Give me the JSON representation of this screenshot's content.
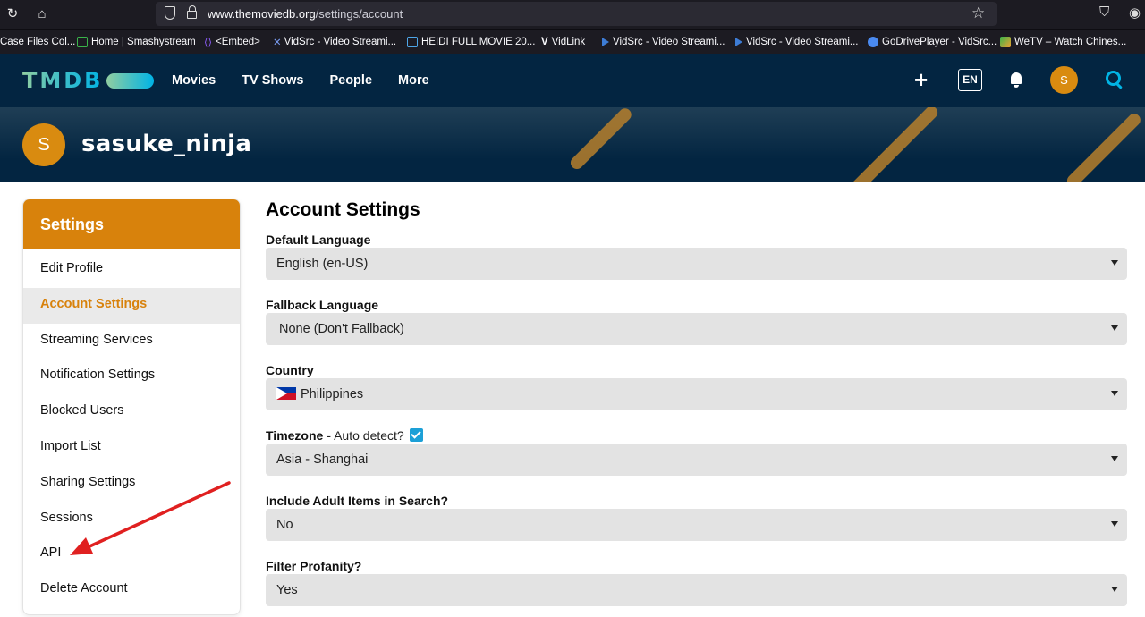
{
  "browser": {
    "url_host": "www.themoviedb.org",
    "url_path": "/settings/account",
    "bookmarks": [
      {
        "label": "Case Files Col...",
        "color": "#ffffff"
      },
      {
        "label": "Home | Smashystream",
        "color": "#3ab54a"
      },
      {
        "label": "<Embed>",
        "color": "#8a5cf5"
      },
      {
        "label": "VidSrc - Video Streami...",
        "color": "#7a9cf0"
      },
      {
        "label": "HEIDI FULL MOVIE 20...",
        "color": "#4ea6e8"
      },
      {
        "label": "VidLink",
        "color": "#ffffff"
      },
      {
        "label": "VidSrc - Video Streami...",
        "color": "#3d7cd5"
      },
      {
        "label": "VidSrc - Video Streami...",
        "color": "#3d7cd5"
      },
      {
        "label": "GoDrivePlayer - VidSrc...",
        "color": "#4a8af0"
      },
      {
        "label": "WeTV – Watch Chines...",
        "color": "#f0a030"
      }
    ]
  },
  "header": {
    "logo": "TMDB",
    "nav": [
      "Movies",
      "TV Shows",
      "People",
      "More"
    ],
    "lang": "EN",
    "avatar_letter": "S"
  },
  "profile": {
    "avatar_letter": "S",
    "username": "sasuke_ninja"
  },
  "sidebar": {
    "title": "Settings",
    "items": [
      {
        "label": "Edit Profile",
        "active": false
      },
      {
        "label": "Account Settings",
        "active": true
      },
      {
        "label": "Streaming Services",
        "active": false
      },
      {
        "label": "Notification Settings",
        "active": false
      },
      {
        "label": "Blocked Users",
        "active": false
      },
      {
        "label": "Import List",
        "active": false
      },
      {
        "label": "Sharing Settings",
        "active": false
      },
      {
        "label": "Sessions",
        "active": false
      },
      {
        "label": "API",
        "active": false
      },
      {
        "label": "Delete Account",
        "active": false
      }
    ]
  },
  "main": {
    "title": "Account Settings",
    "fields": {
      "default_language": {
        "label": "Default Language",
        "value": "English (en-US)"
      },
      "fallback_language": {
        "label": "Fallback Language",
        "value": "None (Don't Fallback)"
      },
      "country": {
        "label": "Country",
        "value": "Philippines"
      },
      "timezone": {
        "label": "Timezone",
        "hint": "- Auto detect?",
        "auto_detect": true,
        "value": "Asia - Shanghai"
      },
      "adult": {
        "label": "Include Adult Items in Search?",
        "value": "No"
      },
      "profanity": {
        "label": "Filter Profanity?",
        "value": "Yes"
      }
    }
  },
  "colors": {
    "header_bg": "#032541",
    "accent": "#d8820c",
    "search": "#01b4e4",
    "arrow": "#e02020"
  }
}
